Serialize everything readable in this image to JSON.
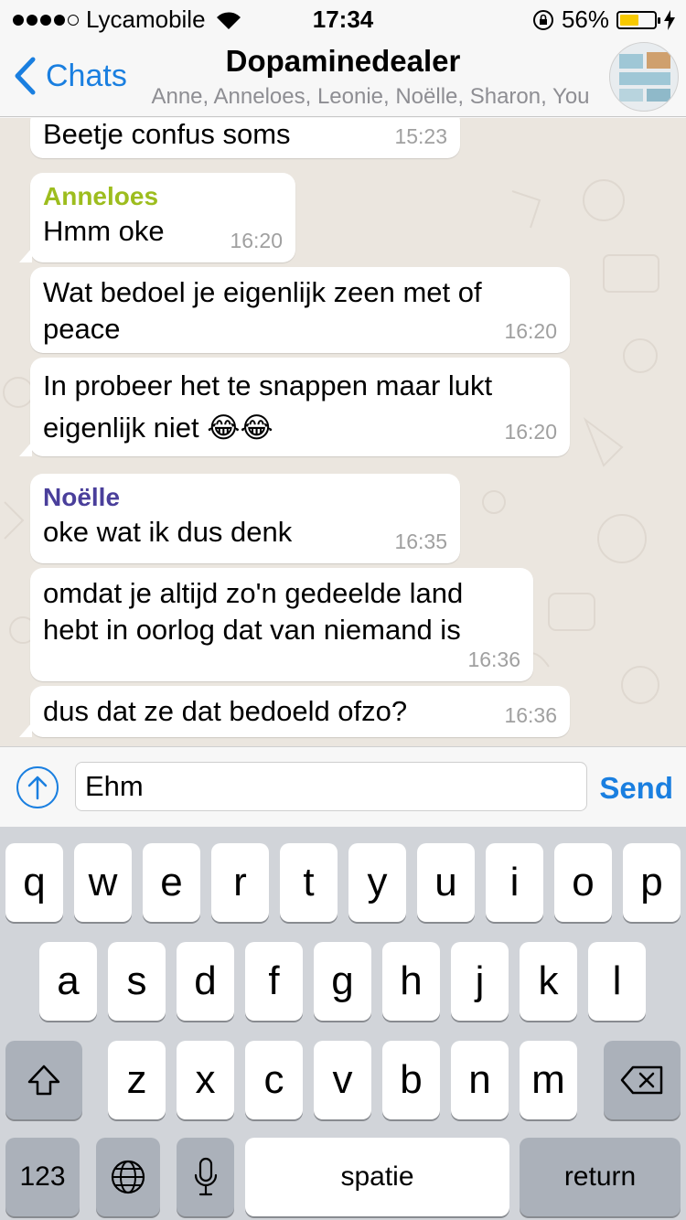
{
  "status_bar": {
    "carrier": "Lycamobile",
    "time": "17:34",
    "battery_percent": "56%",
    "battery_level": 0.56,
    "signal_bars": 4
  },
  "nav": {
    "back_label": "Chats",
    "title": "Dopaminedealer",
    "subtitle": "Anne, Anneloes, Leonie, Noëlle, Sharon, You"
  },
  "messages": [
    {
      "sender": "",
      "text": "Beetje confus soms",
      "time": "15:23"
    },
    {
      "sender": "Anneloes",
      "sender_color": "#9dbd1e",
      "text": "Hmm oke",
      "time": "16:20"
    },
    {
      "sender": "",
      "text": "Wat bedoel je eigenlijk zeen met of peace",
      "time": "16:20"
    },
    {
      "sender": "",
      "text": "In probeer het te snappen maar lukt eigenlijk niet 😂😂",
      "time": "16:20"
    },
    {
      "sender": "Noëlle",
      "sender_color": "#4a3f9b",
      "text": "oke wat ik dus denk",
      "time": "16:35"
    },
    {
      "sender": "",
      "text": "omdat je altijd zo'n gedeelde land hebt in oorlog dat van niemand is",
      "time": "16:36"
    },
    {
      "sender": "",
      "text": "dus dat ze dat bedoeld ofzo?",
      "time": "16:36"
    }
  ],
  "input": {
    "value": "Ehm",
    "send_label": "Send"
  },
  "keyboard": {
    "row1": [
      "q",
      "w",
      "e",
      "r",
      "t",
      "y",
      "u",
      "i",
      "o",
      "p"
    ],
    "row2": [
      "a",
      "s",
      "d",
      "f",
      "g",
      "h",
      "j",
      "k",
      "l"
    ],
    "row3": [
      "z",
      "x",
      "c",
      "v",
      "b",
      "n",
      "m"
    ],
    "numbers_label": "123",
    "space_label": "spatie",
    "return_label": "return"
  },
  "colors": {
    "accent": "#1a7fe0",
    "chat_background": "#ebe6df",
    "bubble": "#ffffff",
    "battery_fill": "#f7c900"
  }
}
